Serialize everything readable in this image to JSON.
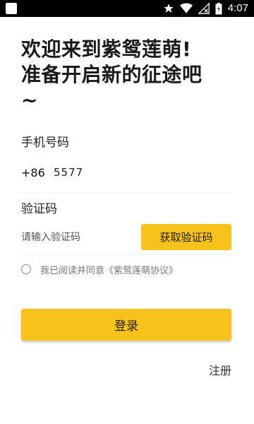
{
  "status_bar": {
    "time": "4:07",
    "icons": [
      "notification-square-icon",
      "star-icon",
      "wifi-icon",
      "no-signal-icon",
      "battery-charging-icon"
    ]
  },
  "header": {
    "title": "欢迎来到紫鸳莲萌!\n准备开启新的征途吧\n~"
  },
  "phone": {
    "label": "手机号码",
    "country_code": "+86",
    "value": "5577"
  },
  "code": {
    "label": "验证码",
    "placeholder": "请输入验证码",
    "get_code_label": "获取验证码"
  },
  "agreement": {
    "text": "我已阅读并同意《紫鸳莲萌协议》",
    "checked": false
  },
  "actions": {
    "login_label": "登录",
    "register_label": "注册"
  },
  "colors": {
    "accent": "#f7c31a",
    "status_bar": "#000000"
  }
}
